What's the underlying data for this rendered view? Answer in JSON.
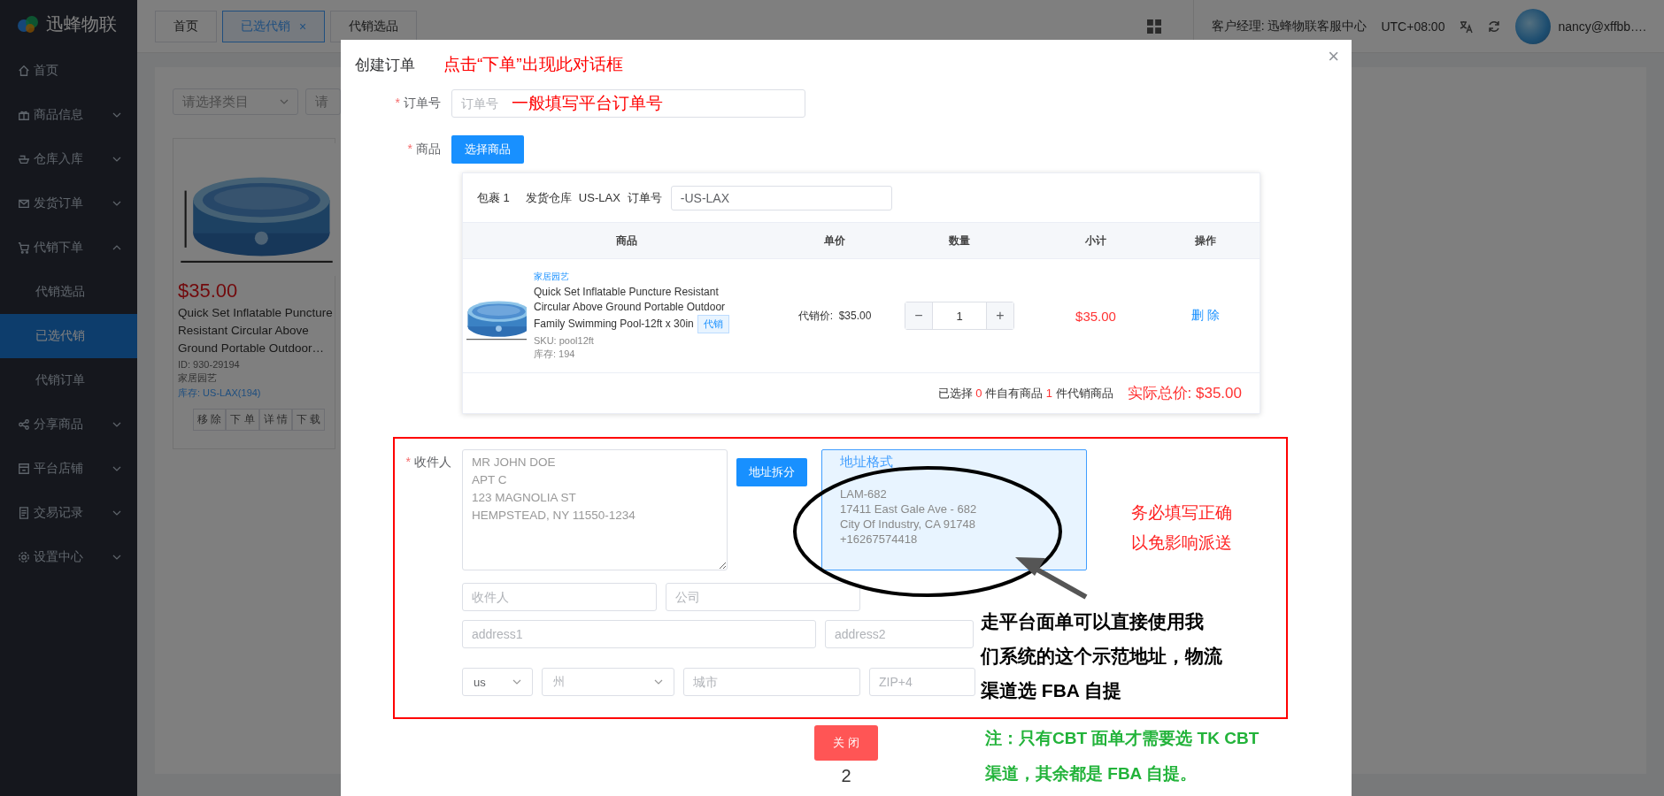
{
  "sidebar": {
    "logo": "迅蜂物联",
    "items": [
      {
        "label": "首页",
        "kind": "link"
      },
      {
        "label": "商品信息",
        "kind": "group",
        "expanded": false
      },
      {
        "label": "仓库入库",
        "kind": "group",
        "expanded": false
      },
      {
        "label": "发货订单",
        "kind": "group",
        "expanded": false
      },
      {
        "label": "代销下单",
        "kind": "group",
        "expanded": true,
        "children": [
          {
            "label": "代销选品",
            "selected": false
          },
          {
            "label": "已选代销",
            "selected": true
          },
          {
            "label": "代销订单",
            "selected": false
          }
        ]
      },
      {
        "label": "分享商品",
        "kind": "group",
        "expanded": false
      },
      {
        "label": "平台店铺",
        "kind": "group",
        "expanded": false
      },
      {
        "label": "交易记录",
        "kind": "group",
        "expanded": false
      },
      {
        "label": "设置中心",
        "kind": "group",
        "expanded": false
      }
    ]
  },
  "tabs": [
    {
      "label": "首页",
      "selected": false
    },
    {
      "label": "已选代销",
      "selected": true,
      "close": "×"
    },
    {
      "label": "代销选品",
      "selected": false
    }
  ],
  "header": {
    "manager": "客户经理: 迅蜂物联客服中心",
    "timezone": "UTC+08:00",
    "user": "nancy@xffbb…."
  },
  "filters": [
    {
      "placeholder": "请选择类目"
    },
    {
      "placeholder": "请"
    }
  ],
  "product_card": {
    "price": "$35.00",
    "title": "Quick Set Inflatable Puncture Resistant Circular Above Ground Portable Outdoor…",
    "id": "ID: 930-29194",
    "category": "家居园艺",
    "stock": "库存: US-LAX(194)",
    "actions": [
      "移 除",
      "下 单",
      "详 情",
      "下 载"
    ]
  },
  "dialog": {
    "title": "创建订单",
    "close": "×",
    "annotation": "点击“下单”出现此对话框",
    "order_field": {
      "label": "订单号",
      "required_mark": "*",
      "placeholder": "订单号",
      "annotation": "一般填写平台订单号"
    },
    "product_field": {
      "label": "商品",
      "required_mark": "*",
      "button": "选择商品"
    },
    "package": {
      "label": "包裹 1",
      "warehouse_label": "发货仓库",
      "warehouse": "US-LAX",
      "order_label": "订单号",
      "order_value": "-US-LAX",
      "columns": [
        "商品",
        "单价",
        "数量",
        "小计",
        "操作"
      ],
      "rows": [
        {
          "category": "家居园艺",
          "title": "Quick Set Inflatable Puncture Resistant Circular Above Ground Portable Outdoor Family Swimming Pool-12ft x 30in",
          "tag": "代销",
          "sku": "SKU: pool12ft",
          "stock": "库存: 194",
          "price": "代销价:  $35.00",
          "decrement": "−",
          "quantity": "1",
          "increment": "+",
          "subtotal": "$35.00",
          "action": "删 除"
        }
      ],
      "summary": {
        "prefix": "已选择",
        "own_count": "0",
        "own_label": "件自有商品",
        "consign_count": "1",
        "consign_label": "件代销商品"
      },
      "total": "实际总价: $35.00"
    },
    "recipient": {
      "label": "收件人",
      "required_mark": "*",
      "address_text": "MR JOHN DOE\nAPT C\n123 MAGNOLIA ST\nHEMPSTEAD, NY 11550-1234",
      "split_button": "地址拆分",
      "format": {
        "title": "地址格式",
        "lines": [
          "LAM-682",
          "17411 East Gale Ave - 682",
          "City Of Industry, CA 91748",
          "+16267574418"
        ]
      },
      "field_rows": [
        [
          {
            "kind": "input",
            "placeholder": "收件人"
          },
          {
            "kind": "input",
            "placeholder": "公司"
          }
        ],
        [
          {
            "kind": "input",
            "placeholder": "address1"
          },
          {
            "kind": "input",
            "placeholder": "address2"
          }
        ],
        [
          {
            "kind": "select",
            "value": "us"
          },
          {
            "kind": "select",
            "placeholder": "州"
          },
          {
            "kind": "input",
            "placeholder": "城市"
          },
          {
            "kind": "input",
            "placeholder": "ZIP+4"
          }
        ]
      ]
    },
    "warning": [
      "务必填写正确",
      "以免影响派送"
    ],
    "platform_note": [
      "走平台面单可以直接使用我",
      "们系统的这个示范地址，物流",
      "渠道选 FBA 自提"
    ],
    "cbt_note": [
      "注：只有CBT 面单才需要选 TK CBT",
      "渠道，其余都是 FBA 自提。"
    ],
    "close_button": "关 闭",
    "page_number": "2"
  }
}
